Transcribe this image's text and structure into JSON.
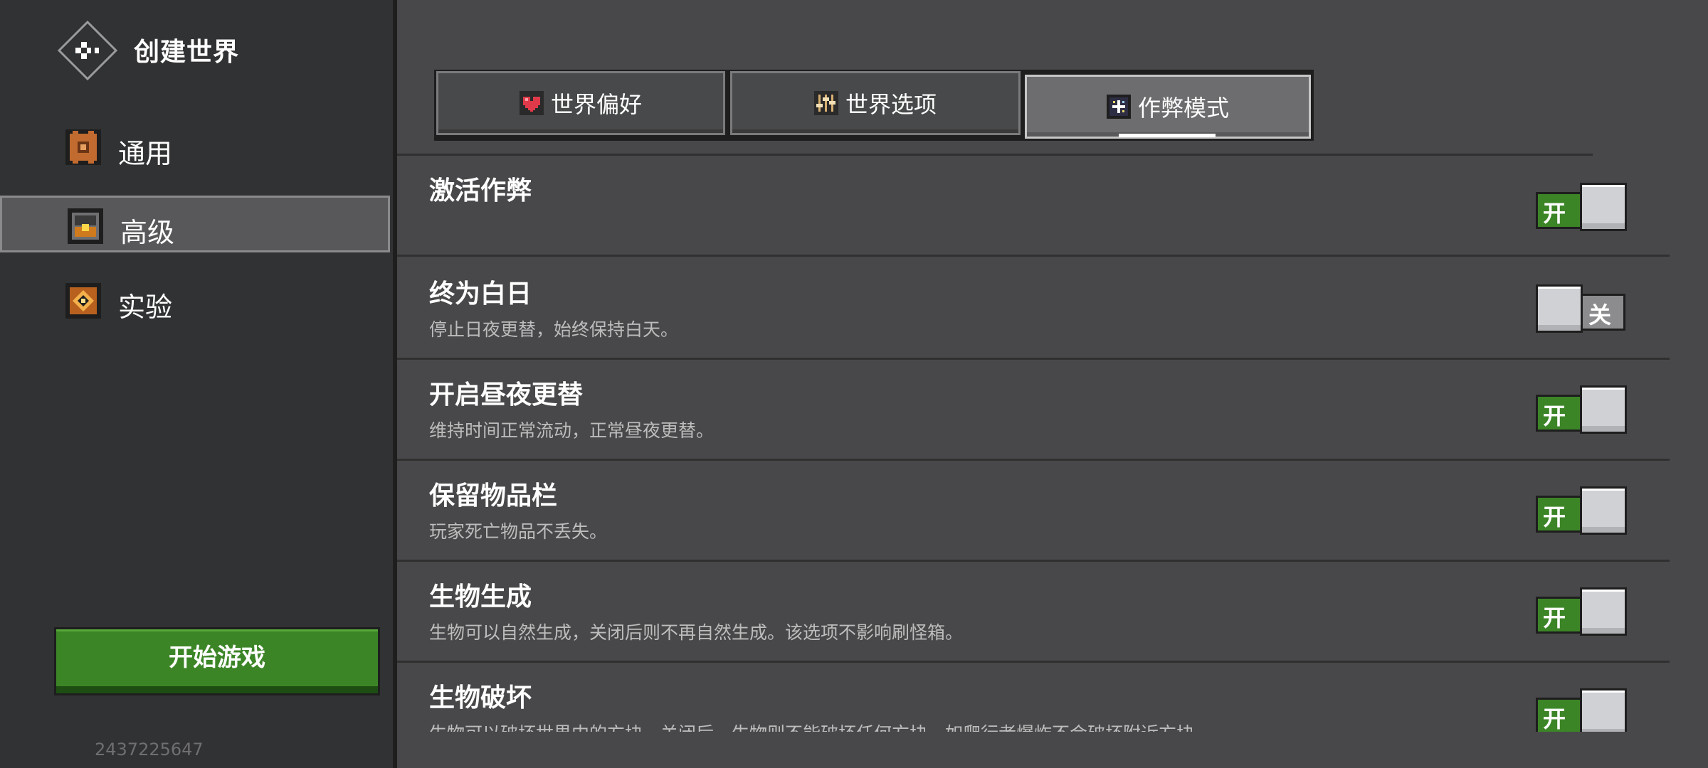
{
  "sidebar": {
    "title": "创建世界",
    "items": [
      {
        "label": "通用",
        "icon": "gear-icon",
        "selected": false
      },
      {
        "label": "高级",
        "icon": "chest-icon",
        "selected": true
      },
      {
        "label": "实验",
        "icon": "flask-icon",
        "selected": false
      }
    ],
    "start_button": "开始游戏",
    "seed": "2437225647"
  },
  "tabs": [
    {
      "label": "世界偏好",
      "icon": "heart-icon",
      "active": false
    },
    {
      "label": "世界选项",
      "icon": "sliders-icon",
      "active": false
    },
    {
      "label": "作弊模式",
      "icon": "sparkle-icon",
      "active": true
    }
  ],
  "settings": [
    {
      "title": "激活作弊",
      "description": "",
      "on": true,
      "state_label": "开"
    },
    {
      "title": "终为白日",
      "description": "停止日夜更替，始终保持白天。",
      "on": false,
      "state_label": "关"
    },
    {
      "title": "开启昼夜更替",
      "description": "维持时间正常流动，正常昼夜更替。",
      "on": true,
      "state_label": "开"
    },
    {
      "title": "保留物品栏",
      "description": "玩家死亡物品不丢失。",
      "on": true,
      "state_label": "开"
    },
    {
      "title": "生物生成",
      "description": "生物可以自然生成，关闭后则不再自然生成。该选项不影响刷怪箱。",
      "on": true,
      "state_label": "开"
    },
    {
      "title": "生物破坏",
      "description": "生物可以破坏世界中的方块，关闭后，生物则不能破坏任何方块，如爬行者爆炸不会破坏附近方块。",
      "on": true,
      "state_label": "开"
    }
  ],
  "colors": {
    "accent_green": "#3c8527",
    "background": "#48484a",
    "sidebar": "#313233"
  }
}
